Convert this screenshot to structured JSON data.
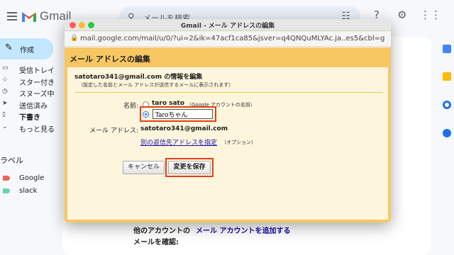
{
  "gmail": {
    "brand": "Gmail",
    "search_placeholder": "メールを検索",
    "compose_label": "作成",
    "nav": [
      {
        "icon": "inbox-icon",
        "label": "受信トレイ",
        "glyph": "▭",
        "bold": false
      },
      {
        "icon": "star-icon",
        "label": "スター付き",
        "glyph": "☆",
        "bold": false
      },
      {
        "icon": "clock-icon",
        "label": "スヌーズ中",
        "glyph": "◷",
        "bold": false
      },
      {
        "icon": "send-icon",
        "label": "送信済み",
        "glyph": "➤",
        "bold": false
      },
      {
        "icon": "draft-icon",
        "label": "下書き",
        "glyph": "▯",
        "bold": true
      },
      {
        "icon": "chevron-down-icon",
        "label": "もっと見る",
        "glyph": "⌄",
        "bold": false
      }
    ],
    "labels_heading": "ラベル",
    "labels": [
      {
        "name": "Google",
        "color": "#e8675a"
      },
      {
        "name": "slack",
        "color": "#68d3b3"
      }
    ],
    "main": {
      "other_accounts": "他のアカウントの",
      "add_mail_account": "メール アカウントを追加する",
      "check_mail": "メールを確認:"
    }
  },
  "popup": {
    "window_title": "Gmail - メール アドレスの編集",
    "url": "mail.google.com/mail/u/0/?ui=2&ik=47acf1ca85&jsver=q4QNQuMLYAc.ja..es5&cbl=g...",
    "dialog_title": "メール アドレスの編集",
    "info_title": "satotaro341@gmail.com の情報を編集",
    "info_sub": "（設定した名前とメール アドレスが送信するメールに表示されます）",
    "name_label": "名前:",
    "option1_name": "taro sato",
    "option1_note": "（Google アカウントの名前）",
    "name_input_value": "Taroちゃん",
    "email_label": "メール アドレス:",
    "email_value": "satotaro341@gmail.com",
    "reply_link": "別の返信先アドレスを指定",
    "optional_note": "（オプション）",
    "cancel_label": "キャンセル",
    "save_label": "変更を保存",
    "selected_option": "custom"
  },
  "colors": {
    "dialog_header": "#f7c763",
    "dialog_body": "#fdf6dd",
    "highlight": "#e0401c",
    "compose_bg": "#c2e7ff",
    "link": "#1a0dab"
  }
}
